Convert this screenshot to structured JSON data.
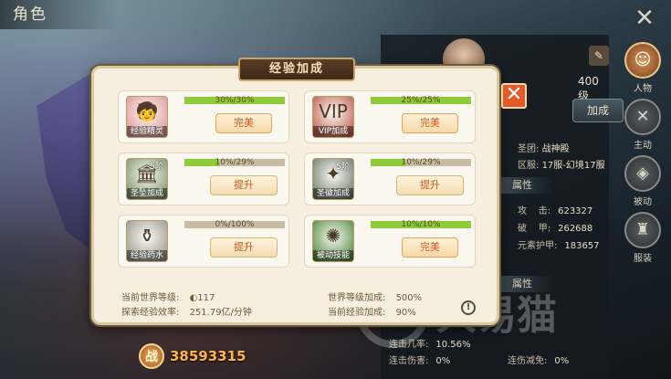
{
  "screen": {
    "title": "角色"
  },
  "power": {
    "badge": "战",
    "value": "38593315"
  },
  "popup": {
    "title": "经验加成",
    "cards": [
      {
        "name": "经验精灵",
        "level": "",
        "progress_text": "30%/30%",
        "progress": 1.0,
        "action": "完美",
        "action_type": "done",
        "glyph": "🧒",
        "bg": "#d98a8a"
      },
      {
        "name": "VIP加成",
        "level": "",
        "progress_text": "25%/25%",
        "progress": 1.0,
        "action": "完美",
        "action_type": "done",
        "glyph": "VIP",
        "bg": "#b84a3a"
      },
      {
        "name": "圣坠加成",
        "level": "5阶",
        "progress_text": "10%/29%",
        "progress": 0.345,
        "action": "提升",
        "action_type": "up",
        "glyph": "🏛",
        "bg": "#6a8a5a"
      },
      {
        "name": "圣徽加成",
        "level": "5阶",
        "progress_text": "10%/29%",
        "progress": 0.345,
        "action": "提升",
        "action_type": "up",
        "glyph": "✦",
        "bg": "#5a6a5a"
      },
      {
        "name": "经验药水",
        "level": "",
        "progress_text": "0%/100%",
        "progress": 0.0,
        "action": "提升",
        "action_type": "up",
        "glyph": "⚱",
        "bg": "#8a8a84"
      },
      {
        "name": "被动技能",
        "level": "",
        "progress_text": "10%/10%",
        "progress": 1.0,
        "action": "完美",
        "action_type": "done",
        "glyph": "✺",
        "bg": "#3a7a2a"
      }
    ],
    "footer": {
      "world_level_label": "当前世界等级:",
      "world_level_value": "117",
      "explore_label": "探索经验效率:",
      "explore_value": "251.79亿/分钟",
      "world_bonus_label": "世界等级加成:",
      "world_bonus_value": "500%",
      "current_bonus_label": "当前经验加成:",
      "current_bonus_value": "90%",
      "info": "!"
    },
    "close": "✕"
  },
  "character_panel": {
    "level": "400级",
    "edit_icon": "✎",
    "boost_button": "加成",
    "guild_label": "圣团:",
    "guild_value": "战神殿",
    "server_label": "区服:",
    "server_value": "17服-幻境17服",
    "attr_section": "属性",
    "attr_section2": "属性",
    "stats": [
      {
        "label": "攻",
        "sub": "击:",
        "value": "623327"
      },
      {
        "label": "破",
        "sub": "甲:",
        "value": "262688"
      },
      {
        "label": "元素护甲:",
        "sub": "",
        "value": "183657"
      }
    ],
    "stats2": [
      {
        "label": "连击几率:",
        "value": "10.56%"
      },
      {
        "label": "连击伤害:",
        "value": "0%"
      },
      {
        "label": "连伤减免:",
        "value": "0%"
      }
    ]
  },
  "side_nav": {
    "close": "✕",
    "items": [
      {
        "label": "人物",
        "icon": "person-icon",
        "glyph": "☺",
        "active": true
      },
      {
        "label": "主动",
        "icon": "swords-icon",
        "glyph": "✕",
        "active": false
      },
      {
        "label": "被动",
        "icon": "shield-icon",
        "glyph": "◈",
        "active": false
      },
      {
        "label": "服装",
        "icon": "armor-icon",
        "glyph": "♜",
        "active": false
      }
    ]
  },
  "watermark": {
    "text": "大易猫"
  }
}
